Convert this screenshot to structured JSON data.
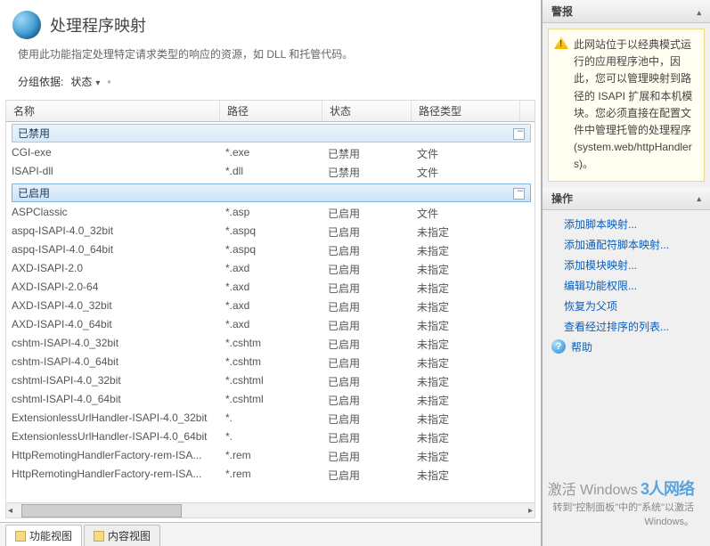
{
  "title": "处理程序映射",
  "description": "使用此功能指定处理特定请求类型的响应的资源，如 DLL 和托管代码。",
  "groupby_label": "分组依据:",
  "groupby_value": "状态",
  "groupby_sep": "•",
  "columns": {
    "name": "名称",
    "path": "路径",
    "state": "状态",
    "type": "路径类型"
  },
  "groups": [
    {
      "label": "已禁用",
      "rows": [
        {
          "name": "CGI-exe",
          "path": "*.exe",
          "state": "已禁用",
          "type": "文件"
        },
        {
          "name": "ISAPI-dll",
          "path": "*.dll",
          "state": "已禁用",
          "type": "文件"
        }
      ]
    },
    {
      "label": "已启用",
      "rows": [
        {
          "name": "ASPClassic",
          "path": "*.asp",
          "state": "已启用",
          "type": "文件"
        },
        {
          "name": "aspq-ISAPI-4.0_32bit",
          "path": "*.aspq",
          "state": "已启用",
          "type": "未指定"
        },
        {
          "name": "aspq-ISAPI-4.0_64bit",
          "path": "*.aspq",
          "state": "已启用",
          "type": "未指定"
        },
        {
          "name": "AXD-ISAPI-2.0",
          "path": "*.axd",
          "state": "已启用",
          "type": "未指定"
        },
        {
          "name": "AXD-ISAPI-2.0-64",
          "path": "*.axd",
          "state": "已启用",
          "type": "未指定"
        },
        {
          "name": "AXD-ISAPI-4.0_32bit",
          "path": "*.axd",
          "state": "已启用",
          "type": "未指定"
        },
        {
          "name": "AXD-ISAPI-4.0_64bit",
          "path": "*.axd",
          "state": "已启用",
          "type": "未指定"
        },
        {
          "name": "cshtm-ISAPI-4.0_32bit",
          "path": "*.cshtm",
          "state": "已启用",
          "type": "未指定"
        },
        {
          "name": "cshtm-ISAPI-4.0_64bit",
          "path": "*.cshtm",
          "state": "已启用",
          "type": "未指定"
        },
        {
          "name": "cshtml-ISAPI-4.0_32bit",
          "path": "*.cshtml",
          "state": "已启用",
          "type": "未指定"
        },
        {
          "name": "cshtml-ISAPI-4.0_64bit",
          "path": "*.cshtml",
          "state": "已启用",
          "type": "未指定"
        },
        {
          "name": "ExtensionlessUrlHandler-ISAPI-4.0_32bit",
          "path": "*.",
          "state": "已启用",
          "type": "未指定"
        },
        {
          "name": "ExtensionlessUrlHandler-ISAPI-4.0_64bit",
          "path": "*.",
          "state": "已启用",
          "type": "未指定"
        },
        {
          "name": "HttpRemotingHandlerFactory-rem-ISA...",
          "path": "*.rem",
          "state": "已启用",
          "type": "未指定"
        },
        {
          "name": "HttpRemotingHandlerFactory-rem-ISA...",
          "path": "*.rem",
          "state": "已启用",
          "type": "未指定"
        }
      ]
    }
  ],
  "side": {
    "alert_title": "警报",
    "alert_text": "此网站位于以经典模式运行的应用程序池中，因此，您可以管理映射到路径的 ISAPI 扩展和本机模块。您必须直接在配置文件中管理托管的处理程序 (system.web/httpHandlers)。",
    "ops_title": "操作",
    "actions": [
      "添加脚本映射...",
      "添加通配符脚本映射...",
      "添加模块映射...",
      "编辑功能权限...",
      "恢复为父项",
      "查看经过排序的列表..."
    ],
    "help": "帮助"
  },
  "tabs": {
    "features": "功能视图",
    "content": "内容视图"
  },
  "watermark": {
    "l1": "激活 Windows",
    "l2": "转到\"控制面板\"中的\"系统\"以激活",
    "l3": "Windows。",
    "logo": "3人网络"
  }
}
